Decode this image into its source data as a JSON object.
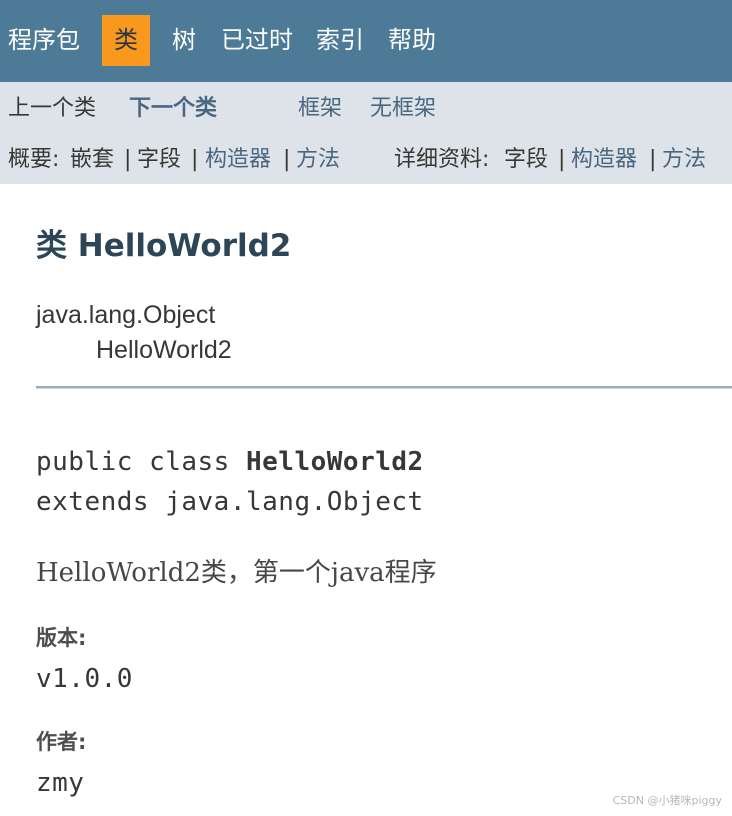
{
  "topnav": {
    "items": [
      {
        "label": "程序包",
        "active": false
      },
      {
        "label": "类",
        "active": true
      },
      {
        "label": "树",
        "active": false
      },
      {
        "label": "已过时",
        "active": false
      },
      {
        "label": "索引",
        "active": false
      },
      {
        "label": "帮助",
        "active": false
      }
    ]
  },
  "subnav": {
    "prev_class": "上一个类",
    "next_class": "下一个类",
    "frames": "框架",
    "no_frames": "无框架",
    "summary_label": "概要:",
    "summary_nested": "嵌套",
    "summary_field": "字段",
    "summary_constructor": "构造器",
    "summary_method": "方法",
    "detail_label": "详细资料:",
    "detail_field": "字段",
    "detail_constructor": "构造器",
    "detail_method": "方法",
    "separator": "|"
  },
  "content": {
    "title": "类 HelloWorld2",
    "inheritance_parent": "java.lang.Object",
    "inheritance_child": "HelloWorld2",
    "signature_prefix": "public class ",
    "signature_name": "HelloWorld2",
    "signature_extends": "extends java.lang.Object",
    "description": "HelloWorld2类，第一个java程序",
    "version_label": "版本:",
    "version_value": "v1.0.0",
    "author_label": "作者:",
    "author_value": "zmy"
  },
  "watermark": "CSDN @小猪咪piggy",
  "colors": {
    "topnav_bg": "#4d7a97",
    "active_tab_bg": "#f8981d",
    "subnav_bg": "#dee3e9",
    "link": "#4a6782",
    "title": "#2c4557"
  }
}
